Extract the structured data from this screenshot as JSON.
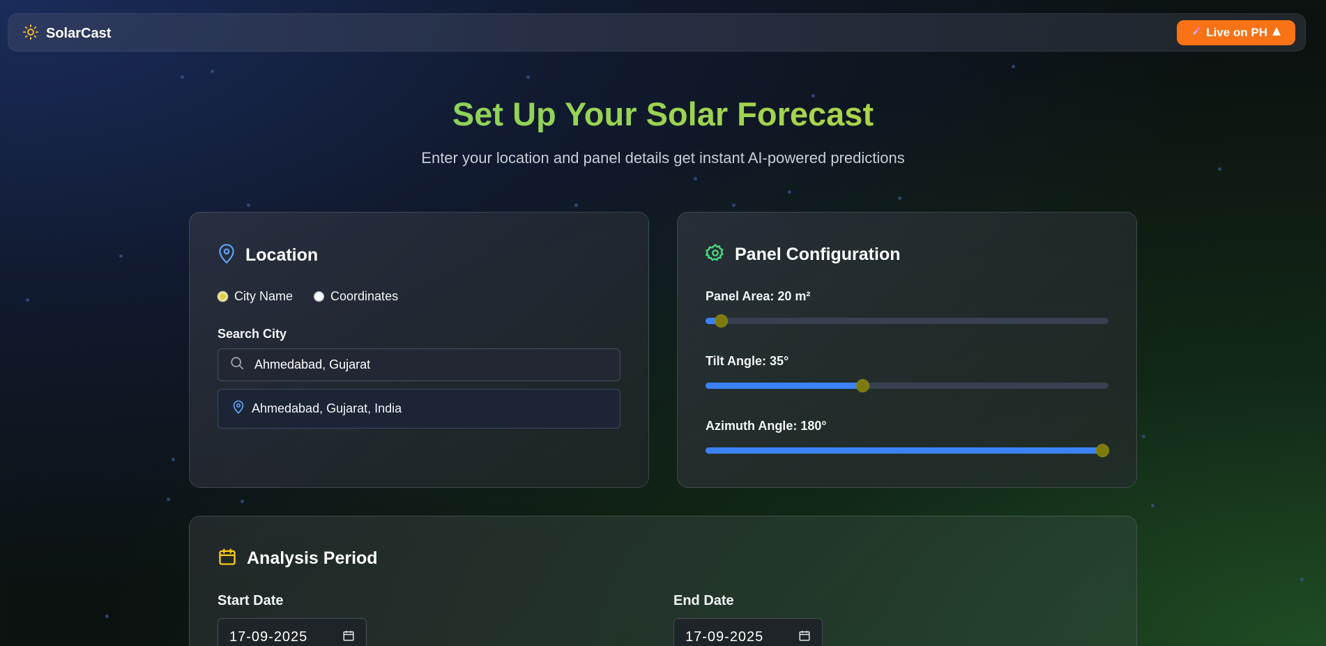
{
  "navbar": {
    "brand": "SolarCast",
    "ph_button": "Live on PH"
  },
  "hero": {
    "title": "Set Up Your Solar Forecast",
    "subtitle": "Enter your location and panel details get instant AI-powered predictions"
  },
  "location": {
    "title": "Location",
    "radio_city": "City Name",
    "radio_coords": "Coordinates",
    "selected_mode": "city",
    "search_label": "Search City",
    "search_value": "Ahmedabad, Gujarat",
    "suggestion": "Ahmedabad, Gujarat, India"
  },
  "panel": {
    "title": "Panel Configuration",
    "area_label": "Panel Area: 20 m²",
    "area_fraction": 0.0,
    "tilt_label": "Tilt Angle: 35°",
    "tilt_fraction": 0.39,
    "azimuth_label": "Azimuth Angle: 180°",
    "azimuth_fraction": 1.0
  },
  "analysis": {
    "title": "Analysis Period",
    "start_label": "Start Date",
    "start_value": "17-09-2025",
    "end_label": "End Date",
    "end_value": "17-09-2025"
  },
  "colors": {
    "accent_blue": "#3b82f6",
    "orange": "#f97316",
    "slider_thumb": "#7c7a0a"
  }
}
